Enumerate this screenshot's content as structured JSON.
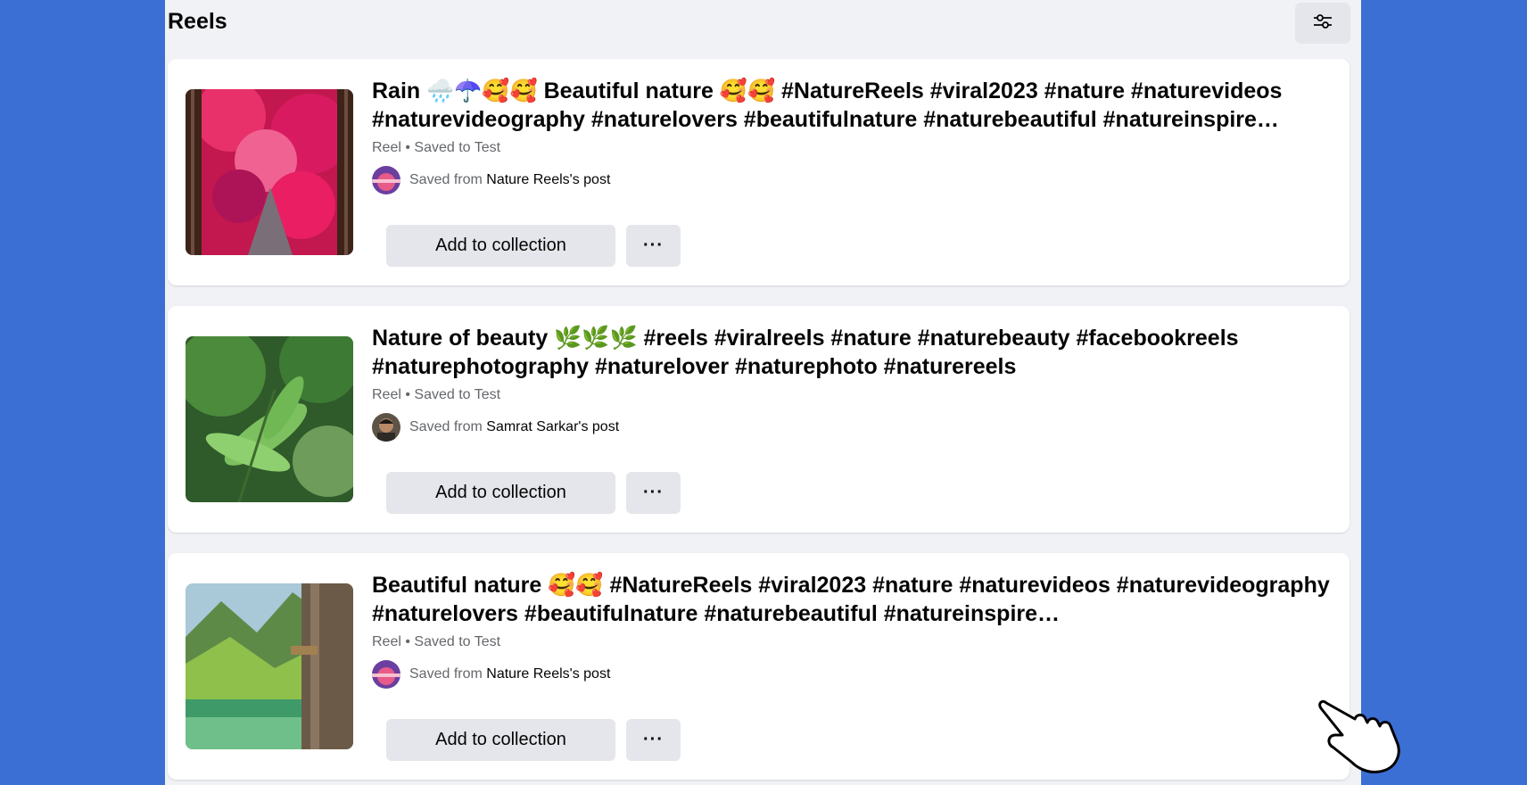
{
  "header": {
    "title": "Reels",
    "filter_icon": "sliders-icon"
  },
  "items": [
    {
      "title": "Rain 🌧️☂️🥰🥰 Beautiful nature 🥰🥰 #NatureReels #viral2023 #nature #naturevideos #naturevideography #naturelovers #beautifulnature #naturebeautiful #natureinspire…",
      "meta": "Reel • Saved to Test",
      "saved_prefix": "Saved from ",
      "source": "Nature Reels's post",
      "add_label": "Add to collection",
      "more_label": "···"
    },
    {
      "title": "Nature of beauty 🌿🌿🌿 #reels #viralreels #nature #naturebeauty #facebookreels #naturephotography #naturelover #naturephoto #naturereels",
      "meta": "Reel • Saved to Test",
      "saved_prefix": "Saved from ",
      "source": "Samrat Sarkar's post",
      "add_label": "Add to collection",
      "more_label": "···"
    },
    {
      "title": "Beautiful nature 🥰🥰 #NatureReels #viral2023 #nature #naturevideos #naturevideography #naturelovers #beautifulnature #naturebeautiful #natureinspire…",
      "meta": "Reel • Saved to Test",
      "saved_prefix": "Saved from ",
      "source": "Nature Reels's post",
      "add_label": "Add to collection",
      "more_label": "···"
    }
  ],
  "colors": {
    "background": "#3b6fd4",
    "panel": "#f0f2f5",
    "button": "#e4e6eb"
  }
}
